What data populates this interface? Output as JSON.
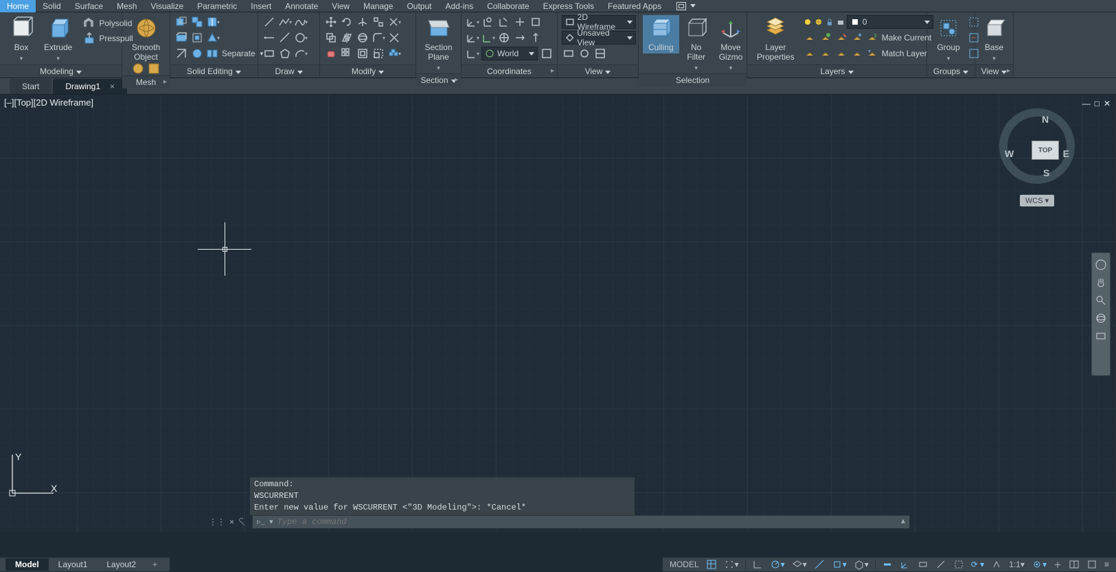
{
  "menubar": {
    "items": [
      "Home",
      "Solid",
      "Surface",
      "Mesh",
      "Visualize",
      "Parametric",
      "Insert",
      "Annotate",
      "View",
      "Manage",
      "Output",
      "Add-ins",
      "Collaborate",
      "Express Tools",
      "Featured Apps"
    ],
    "active_index": 0
  },
  "ribbon": {
    "modeling": {
      "title": "Modeling",
      "box": "Box",
      "extrude": "Extrude",
      "polysolid": "Polysolid",
      "presspull": "Presspull",
      "smooth": "Smooth\nObject"
    },
    "mesh": {
      "title": "Mesh"
    },
    "solid_editing": {
      "title": "Solid Editing",
      "separate": "Separate"
    },
    "draw": {
      "title": "Draw"
    },
    "modify": {
      "title": "Modify"
    },
    "section": {
      "title": "Section",
      "plane": "Section\nPlane"
    },
    "coordinates": {
      "title": "Coordinates",
      "world": "World"
    },
    "view": {
      "title": "View",
      "visual_style": "2D Wireframe",
      "unsaved_view": "Unsaved View"
    },
    "selection": {
      "title": "Selection",
      "culling": "Culling",
      "nofilter": "No Filter",
      "movegizmo": "Move\nGizmo"
    },
    "layers": {
      "title": "Layers",
      "properties": "Layer\nProperties",
      "make_current": "Make Current",
      "match_layer": "Match Layer",
      "layer_combo": "0"
    },
    "groups": {
      "title": "Groups",
      "group": "Group"
    },
    "view_panel": {
      "title": "View",
      "base": "Base"
    }
  },
  "tabs": {
    "start": "Start",
    "drawing": "Drawing1"
  },
  "viewport": {
    "label": "[–][Top][2D Wireframe]",
    "viewcube": {
      "face": "TOP",
      "n": "N",
      "s": "S",
      "e": "E",
      "w": "W",
      "wcs": "WCS"
    }
  },
  "ucs": {
    "x": "X",
    "y": "Y"
  },
  "command": {
    "hist1": "Command:",
    "hist2": "WSCURRENT",
    "hist3": "Enter new value for WSCURRENT <\"3D Modeling\">: *Cancel*",
    "placeholder": "Type a command"
  },
  "layout_tabs": {
    "model": "Model",
    "layout1": "Layout1",
    "layout2": "Layout2"
  },
  "statusbar": {
    "model": "MODEL",
    "scale": "1:1"
  }
}
